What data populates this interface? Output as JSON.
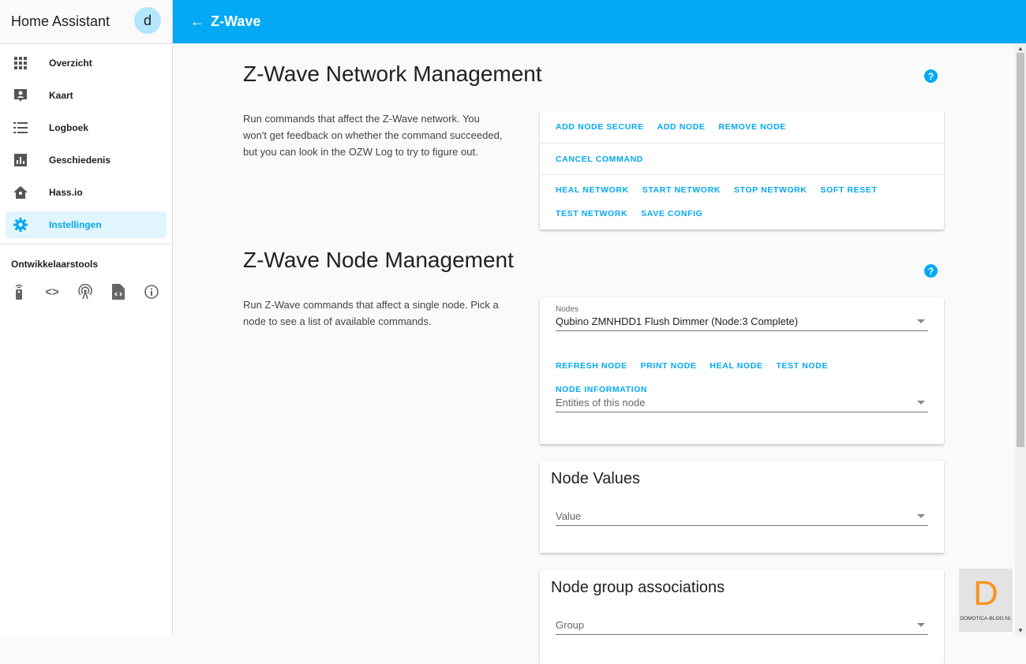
{
  "sidebar": {
    "title": "Home Assistant",
    "avatar": "d",
    "items": [
      {
        "label": "Overzicht",
        "icon": "apps-icon"
      },
      {
        "label": "Kaart",
        "icon": "map-account-icon"
      },
      {
        "label": "Logboek",
        "icon": "list-icon"
      },
      {
        "label": "Geschiedenis",
        "icon": "chart-icon"
      },
      {
        "label": "Hass.io",
        "icon": "hassio-icon"
      },
      {
        "label": "Instellingen",
        "icon": "gear-icon"
      }
    ],
    "dev_title": "Ontwikkelaarstools"
  },
  "header": {
    "title": "Z-Wave"
  },
  "network": {
    "title": "Z-Wave Network Management",
    "description": "Run commands that affect the Z-Wave network. You won't get feedback on whether the command succeeded, but you can look in the OZW Log to try to figure out.",
    "buttons": [
      "ADD NODE SECURE",
      "ADD NODE",
      "REMOVE NODE",
      "CANCEL COMMAND",
      "HEAL NETWORK",
      "START NETWORK",
      "STOP NETWORK",
      "SOFT RESET",
      "TEST NETWORK",
      "SAVE CONFIG"
    ]
  },
  "node": {
    "title": "Z-Wave Node Management",
    "description": "Run Z-Wave commands that affect a single node. Pick a node to see a list of available commands.",
    "nodes_label": "Nodes",
    "nodes_value": "Qubino ZMNHDD1 Flush Dimmer (Node:3 Complete)",
    "buttons": [
      "REFRESH NODE",
      "PRINT NODE",
      "HEAL NODE",
      "TEST NODE",
      "NODE INFORMATION"
    ],
    "entities_placeholder": "Entities of this node"
  },
  "values": {
    "title": "Node Values",
    "placeholder": "Value"
  },
  "groups": {
    "title": "Node group associations",
    "placeholder": "Group"
  },
  "watermark": {
    "text": "DOMOTICA-BLOG.NL",
    "letter": "D"
  },
  "help": "?",
  "colors": {
    "accent": "#03a9f4",
    "active_bg": "#e1f5fe",
    "logo": "#f7941d"
  }
}
